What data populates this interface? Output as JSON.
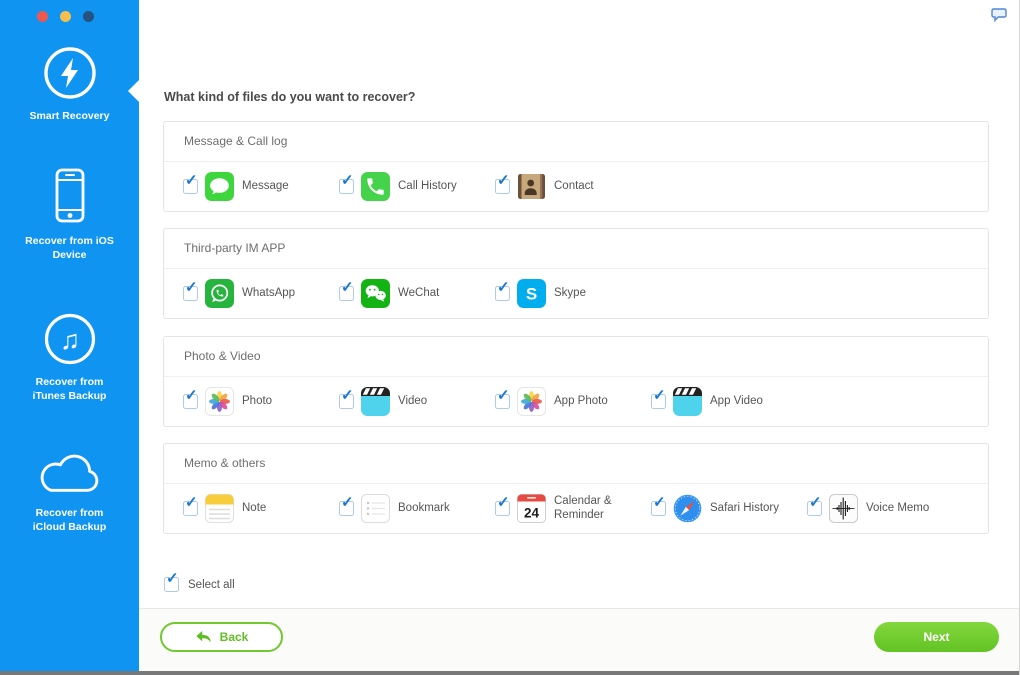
{
  "window": {
    "traffic_lights": [
      {
        "name": "close",
        "color": "#F2574E"
      },
      {
        "name": "minimize",
        "color": "#F5BE4E"
      },
      {
        "name": "zoom",
        "color": "#27517E"
      }
    ]
  },
  "sidebar": {
    "background": "#1094F1",
    "items": [
      {
        "id": "smart-recovery",
        "label": "Smart Recovery",
        "icon": "lightning-circle-icon",
        "active": true
      },
      {
        "id": "recover-from-ios-device",
        "label": "Recover from iOS\nDevice",
        "icon": "iphone-icon",
        "active": false
      },
      {
        "id": "recover-from-itunes-backup",
        "label": "Recover from\niTunes Backup",
        "icon": "music-note-circle-icon",
        "active": false
      },
      {
        "id": "recover-from-icloud-backup",
        "label": "Recover from\niCloud Backup",
        "icon": "cloud-icon",
        "active": false
      }
    ]
  },
  "main": {
    "question": "What kind of files do you want to recover?",
    "sections": [
      {
        "title": "Message & Call log",
        "items": [
          {
            "label": "Message",
            "icon": "message-icon",
            "checked": true
          },
          {
            "label": "Call History",
            "icon": "call-history-icon",
            "checked": true
          },
          {
            "label": "Contact",
            "icon": "contact-icon",
            "checked": true
          }
        ]
      },
      {
        "title": "Third-party IM APP",
        "items": [
          {
            "label": "WhatsApp",
            "icon": "whatsapp-icon",
            "checked": true
          },
          {
            "label": "WeChat",
            "icon": "wechat-icon",
            "checked": true
          },
          {
            "label": "Skype",
            "icon": "skype-icon",
            "checked": true
          }
        ]
      },
      {
        "title": "Photo & Video",
        "items": [
          {
            "label": "Photo",
            "icon": "photo-icon",
            "checked": true
          },
          {
            "label": "Video",
            "icon": "video-icon",
            "checked": true
          },
          {
            "label": "App Photo",
            "icon": "photo-icon",
            "checked": true
          },
          {
            "label": "App Video",
            "icon": "video-icon",
            "checked": true
          }
        ]
      },
      {
        "title": "Memo & others",
        "items": [
          {
            "label": "Note",
            "icon": "note-icon",
            "checked": true
          },
          {
            "label": "Bookmark",
            "icon": "bookmark-icon",
            "checked": true
          },
          {
            "label": "Calendar &\nReminder",
            "icon": "calendar-icon",
            "checked": true
          },
          {
            "label": "Safari History",
            "icon": "safari-icon",
            "checked": true
          },
          {
            "label": "Voice Memo",
            "icon": "voice-memo-icon",
            "checked": true
          }
        ]
      }
    ],
    "select_all": {
      "label": "Select all",
      "checked": true
    },
    "buttons": {
      "back": "Back",
      "next": "Next"
    },
    "colors": {
      "accent_green": "#67C42A",
      "checkbox_blue": "#1877D2"
    }
  }
}
